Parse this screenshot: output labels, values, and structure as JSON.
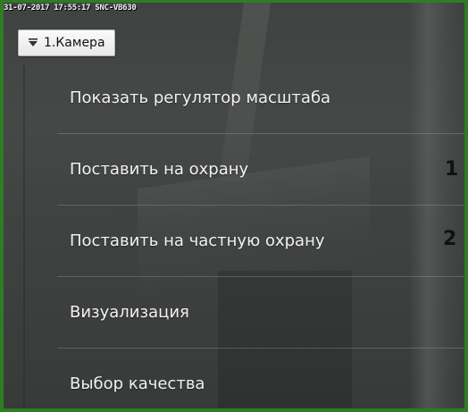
{
  "timestamp": "31-07-2017 17:55:17 SNC-VB630",
  "camera_tab": {
    "label": "1.Камера",
    "icon": "chevron-down-icon"
  },
  "menu": {
    "items": [
      {
        "label": "Показать регулятор масштаба"
      },
      {
        "label": "Поставить на охрану"
      },
      {
        "label": "Поставить на частную охрану"
      },
      {
        "label": "Визуализация"
      },
      {
        "label": "Выбор качества"
      }
    ]
  },
  "callouts": [
    "1",
    "2"
  ],
  "colors": {
    "border": "#2e7d23",
    "menu_text": "#f2f2f2",
    "overlay": "#282a29"
  }
}
